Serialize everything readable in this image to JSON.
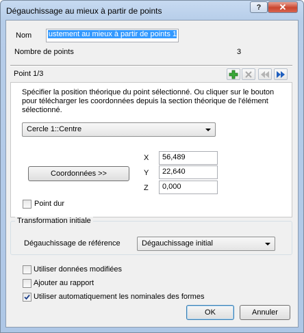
{
  "window": {
    "title": "Dégauchissage au mieux à partir de points",
    "help_label": "?",
    "close_label": "✕"
  },
  "name": {
    "label": "Nom",
    "value": "ustement au mieux à partir de points 1"
  },
  "point_count": {
    "label": "Nombre de points",
    "value": "3"
  },
  "point_nav": {
    "label": "Point 1/3",
    "add_icon": "plus-icon",
    "delete_icon": "x-icon",
    "prev_icon": "double-left-icon",
    "next_icon": "double-right-icon"
  },
  "instructions": "Spécifier la position théorique du point sélectionné. Ou cliquer sur le bouton pour télécharger les coordonnées depuis la section théorique de l'élément sélectionné.",
  "feature_select": {
    "value": "Cercle 1::Centre"
  },
  "coordinates": {
    "button_label": "Coordonnées >>",
    "x": {
      "label": "X",
      "value": "56,489"
    },
    "y": {
      "label": "Y",
      "value": "22,640"
    },
    "z": {
      "label": "Z",
      "value": "0,000"
    }
  },
  "hard_point": {
    "label": "Point dur",
    "checked": false
  },
  "initial_transform": {
    "group_label": "Transformation initiale",
    "ref_label": "Dégauchissage de référence",
    "ref_value": "Dégauchissage initial"
  },
  "options": [
    {
      "label": "Utiliser données modifiées",
      "checked": false
    },
    {
      "label": "Ajouter au rapport",
      "checked": false
    },
    {
      "label": "Utiliser automatiquement les nominales des formes",
      "checked": true
    }
  ],
  "footer": {
    "ok_label": "OK",
    "cancel_label": "Annuler"
  },
  "colors": {
    "accent": "#3399ff",
    "add_green": "#2e9e2e",
    "nav_blue": "#1f5fbf"
  }
}
